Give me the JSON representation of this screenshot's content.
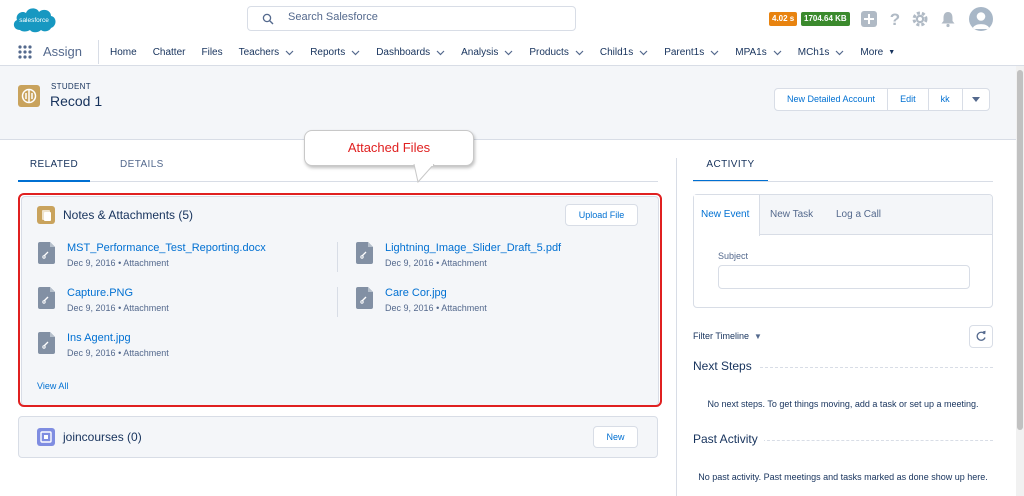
{
  "header": {
    "logo_text": "salesforce",
    "search_placeholder": "Search Salesforce",
    "perf_time": "4.02 s",
    "perf_mem": "1704.64 KB"
  },
  "nav": {
    "app_name": "Assign",
    "items": [
      {
        "label": "Home",
        "dropdown": false
      },
      {
        "label": "Chatter",
        "dropdown": false
      },
      {
        "label": "Files",
        "dropdown": false
      },
      {
        "label": "Teachers",
        "dropdown": true
      },
      {
        "label": "Reports",
        "dropdown": true
      },
      {
        "label": "Dashboards",
        "dropdown": true
      },
      {
        "label": "Analysis",
        "dropdown": true
      },
      {
        "label": "Products",
        "dropdown": true
      },
      {
        "label": "Child1s",
        "dropdown": true
      },
      {
        "label": "Parent1s",
        "dropdown": true
      },
      {
        "label": "MPA1s",
        "dropdown": true
      },
      {
        "label": "MCh1s",
        "dropdown": true
      }
    ],
    "more_label": "More"
  },
  "record": {
    "type": "STUDENT",
    "name": "Recod 1",
    "buttons": {
      "new_detailed_account": "New Detailed Account",
      "edit": "Edit",
      "kk": "kk"
    }
  },
  "tabs": {
    "related": "RELATED",
    "details": "DETAILS"
  },
  "callout": "Attached Files",
  "notes": {
    "title": "Notes & Attachments (5)",
    "upload_button": "Upload File",
    "files": [
      {
        "name": "MST_Performance_Test_Reporting.docx",
        "date": "Dec 9, 2016",
        "kind": "Attachment"
      },
      {
        "name": "Lightning_Image_Slider_Draft_5.pdf",
        "date": "Dec 9, 2016",
        "kind": "Attachment"
      },
      {
        "name": "Capture.PNG",
        "date": "Dec 9, 2016",
        "kind": "Attachment"
      },
      {
        "name": "Care Cor.jpg",
        "date": "Dec 9, 2016",
        "kind": "Attachment"
      },
      {
        "name": "Ins Agent.jpg",
        "date": "Dec 9, 2016",
        "kind": "Attachment"
      }
    ],
    "separator": "•",
    "view_all": "View All"
  },
  "joincourses": {
    "title": "joincourses (0)",
    "new_button": "New"
  },
  "activity": {
    "tab": "ACTIVITY",
    "publisher_tabs": [
      "New Event",
      "New Task",
      "Log a Call"
    ],
    "subject_label": "Subject",
    "filter_label": "Filter Timeline",
    "next_steps_title": "Next Steps",
    "next_steps_empty": "No next steps. To get things moving, add a task or set up a meeting.",
    "past_activity_title": "Past Activity",
    "past_activity_empty": "No past activity. Past meetings and tasks marked as done show up here."
  },
  "colors": {
    "brand_blue": "#0070d2",
    "highlight_red": "#e02020",
    "record_icon": "#c9a35d",
    "notes_icon": "#c9a35d",
    "join_icon": "#7f8de1"
  },
  "icons": {
    "logo": "salesforce-cloud",
    "search": "search-icon",
    "add": "add-icon",
    "help": "help-icon",
    "setup": "gear-icon",
    "notifications": "bell-icon",
    "user": "avatar",
    "app_launcher": "waffle-icon",
    "record": "student-icon",
    "file": "attachment-file-icon",
    "refresh": "refresh-icon"
  }
}
